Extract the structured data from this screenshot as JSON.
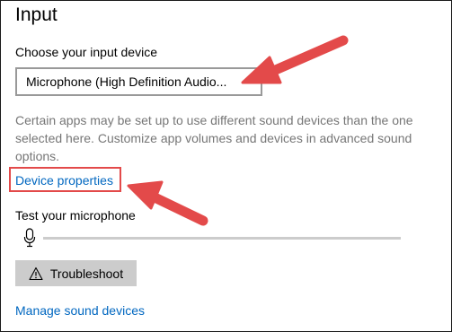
{
  "section": {
    "title": "Input"
  },
  "input_device": {
    "label": "Choose your input device",
    "selected": "Microphone (High Definition Audio..."
  },
  "help_text": "Certain apps may be set up to use different sound devices than the one selected here. Customize app volumes and devices in advanced sound options.",
  "device_properties_link": "Device properties",
  "test_mic": {
    "label": "Test your microphone",
    "level": 0
  },
  "troubleshoot_button": {
    "label": "Troubleshoot",
    "icon": "warning-triangle-icon"
  },
  "manage_link": "Manage sound devices",
  "colors": {
    "link": "#0067c0",
    "annotation": "#e34a4a",
    "help_text": "#767676",
    "button_bg": "#cccccc"
  }
}
